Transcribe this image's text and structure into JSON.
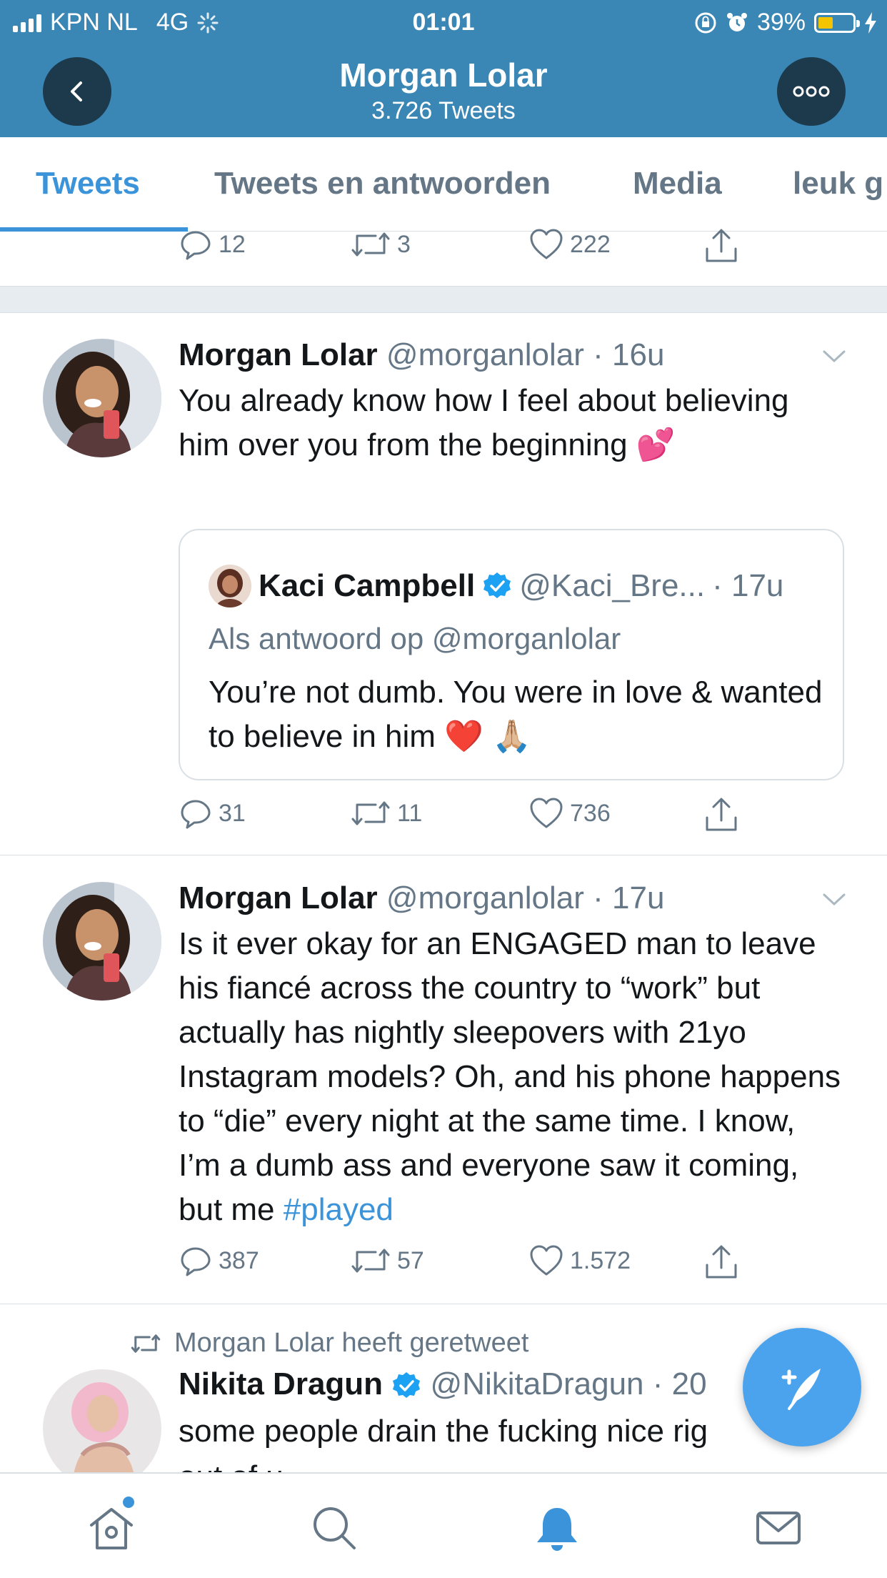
{
  "status_bar": {
    "carrier": "KPN NL",
    "network": "4G",
    "time": "01:01",
    "battery_percent": "39%",
    "battery_level": 0.39
  },
  "header": {
    "title": "Morgan Lolar",
    "subtitle": "3.726 Tweets"
  },
  "tabs": [
    {
      "label": "Tweets",
      "active": true
    },
    {
      "label": "Tweets en antwoorden",
      "active": false
    },
    {
      "label": "Media",
      "active": false
    },
    {
      "label": "leuk g",
      "active": false
    }
  ],
  "tweets": [
    {
      "actions": {
        "replies": "12",
        "retweets": "3",
        "likes": "222"
      }
    },
    {
      "name": "Morgan Lolar",
      "handle": "@morganlolar",
      "time": "· 16u",
      "text": "You already know how I feel about believing him over you from the beginning 💕",
      "quote": {
        "name": "Kaci Campbell",
        "handle": "@Kaci_Bre...",
        "time": "· 17u",
        "reply_to": "Als antwoord op @morganlolar",
        "text": "You’re not dumb. You were in love & wanted to believe in him ❤️ 🙏🏼"
      },
      "actions": {
        "replies": "31",
        "retweets": "11",
        "likes": "736"
      }
    },
    {
      "name": "Morgan Lolar",
      "handle": "@morganlolar",
      "time": "· 17u",
      "text": "Is it ever okay for an ENGAGED man to leave his fiancé across the country to “work” but actually has nightly sleepovers with 21yo Instagram models? Oh, and his phone happens to “die” every night at the same time. I know, I’m a dumb ass and everyone saw it coming, but me ",
      "hashtag": "#played",
      "actions": {
        "replies": "387",
        "retweets": "57",
        "likes": "1.572"
      }
    },
    {
      "retweeted_by": "Morgan Lolar heeft geretweet",
      "name": "Nikita Dragun",
      "handle": "@NikitaDragun",
      "time": "· 20",
      "text": "some people drain the fucking nice rig",
      "text_cont": "out of u"
    }
  ],
  "icons": {
    "back": "chevron-left-icon",
    "more": "more-dots-icon",
    "reply": "reply-icon",
    "retweet": "retweet-icon",
    "like": "heart-icon",
    "share": "share-icon",
    "home": "home-icon",
    "search": "search-icon",
    "notifications": "bell-icon",
    "messages": "mail-icon",
    "compose": "compose-icon",
    "verified": "verified-badge-icon"
  },
  "colors": {
    "header_bg": "#3a86b4",
    "accent": "#3b94d9",
    "muted": "#657786",
    "fab": "#4aa3ec",
    "verified": "#1da1f2"
  }
}
